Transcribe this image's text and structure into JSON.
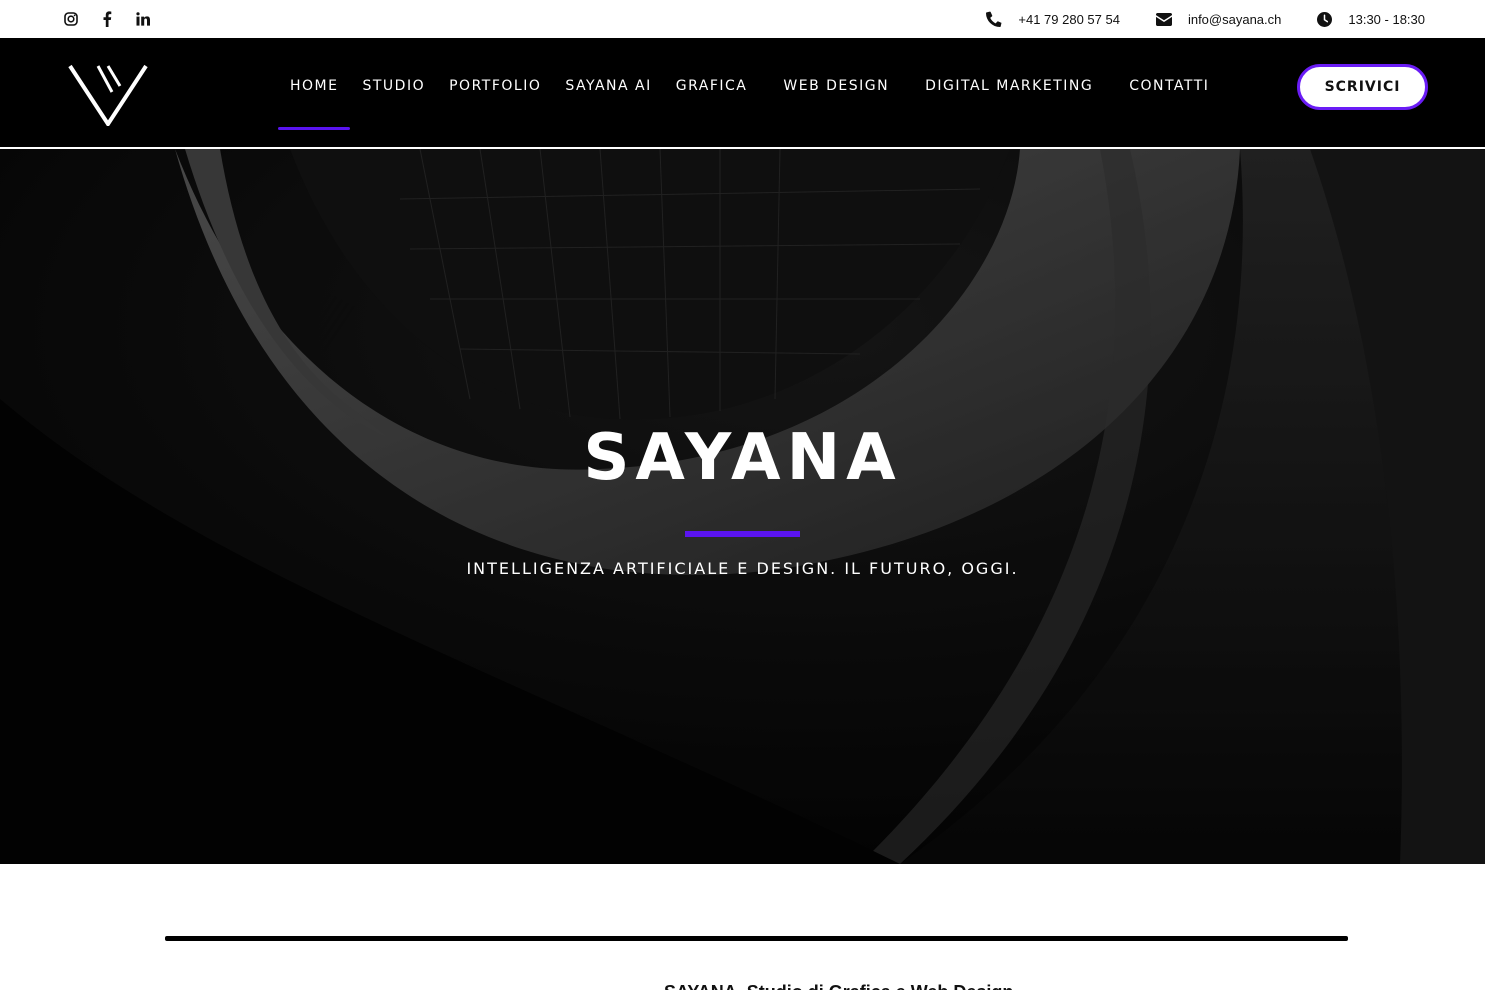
{
  "topbar": {
    "social": [
      {
        "icon": "instagram-icon",
        "label": "Instagram"
      },
      {
        "icon": "facebook-icon",
        "label": "Facebook"
      },
      {
        "icon": "linkedin-icon",
        "label": "LinkedIn"
      }
    ],
    "phone": "+41 79 280 57 54",
    "email": "info@sayana.ch",
    "hours": "13:30 - 18:30"
  },
  "header": {
    "nav": [
      {
        "label": "HOME",
        "active": true
      },
      {
        "label": "STUDIO"
      },
      {
        "label": "PORTFOLIO"
      },
      {
        "label": "SAYANA AI"
      },
      {
        "label": "GRAFICA"
      },
      {
        "label": "WEB DESIGN"
      },
      {
        "label": "DIGITAL MARKETING"
      },
      {
        "label": "CONTATTI"
      }
    ],
    "cta_label": "SCRIVICI"
  },
  "hero": {
    "title": "SAYANA",
    "subtitle": "INTELLIGENZA ARTIFICIALE E DESIGN. IL FUTURO, OGGI."
  },
  "section": {
    "intro": "SAYANA, Studio di Grafica e Web Design"
  },
  "colors": {
    "accent": "#5a14f0",
    "header_bg": "#000000",
    "hero_bg": "#050505"
  }
}
